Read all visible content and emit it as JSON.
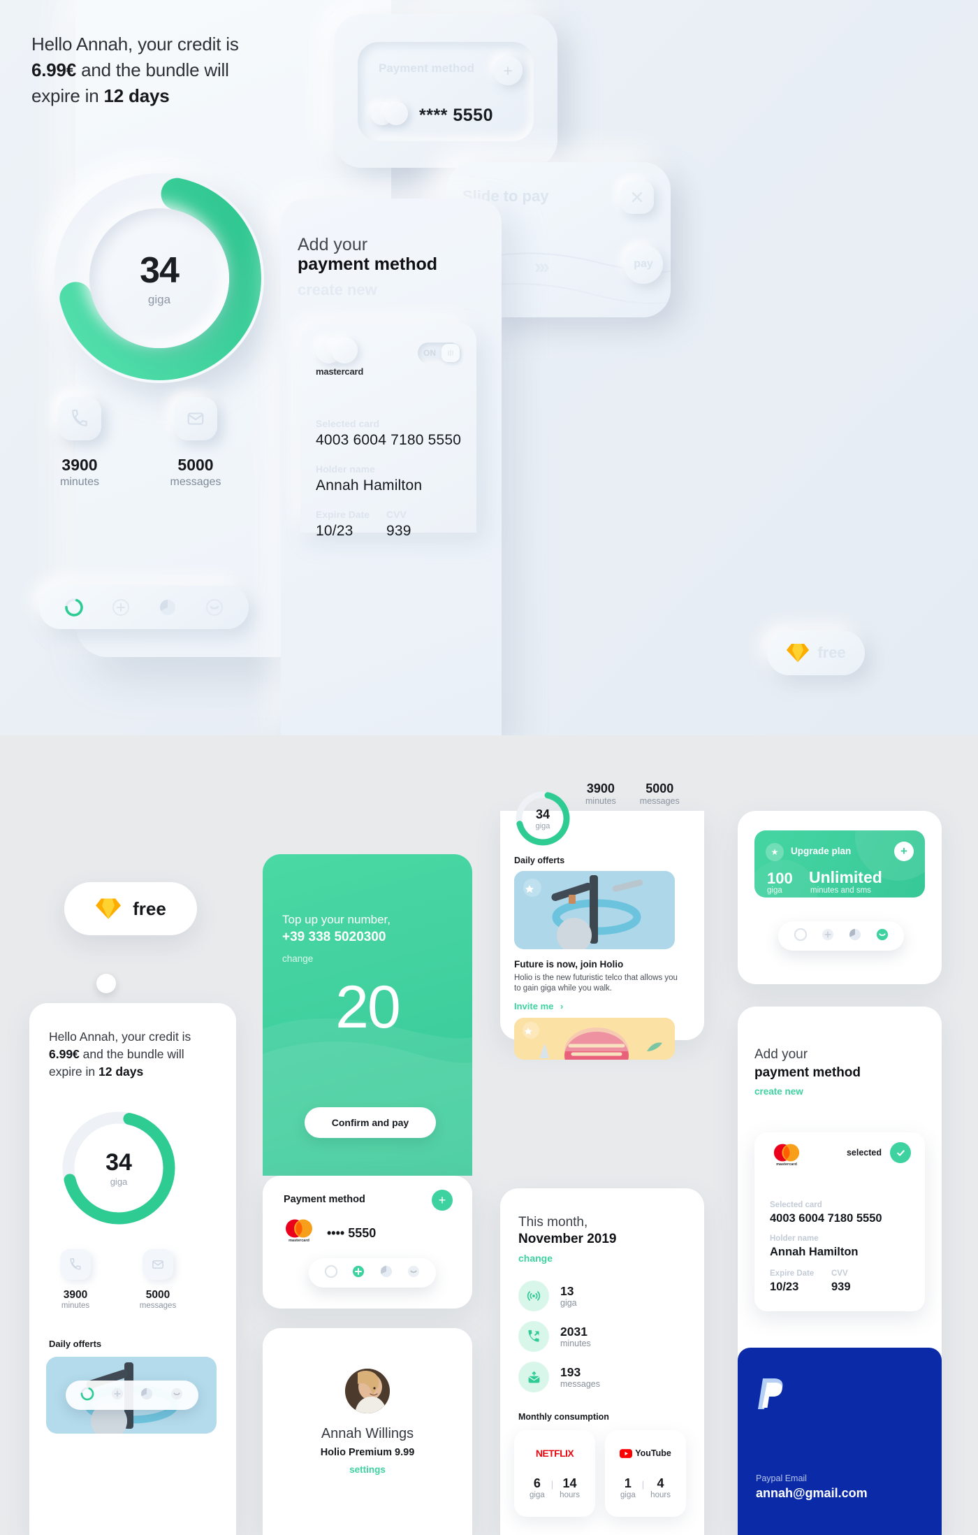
{
  "top": {
    "greeting": {
      "pre": "Hello Annah, your credit is ",
      "credit": "6.99€",
      "mid": " and the bundle will expire in ",
      "days": "12 days"
    },
    "donut": {
      "value": "34",
      "unit": "giga",
      "percent": 68
    },
    "stats": [
      {
        "icon": "phone-icon",
        "value": "3900",
        "label": "minutes"
      },
      {
        "icon": "envelope-icon",
        "value": "5000",
        "label": "messages"
      }
    ],
    "nav": [
      {
        "icon": "ring-icon",
        "active": true
      },
      {
        "icon": "plus-icon",
        "active": false
      },
      {
        "icon": "pie-icon",
        "active": false
      },
      {
        "icon": "smiley-icon",
        "active": false
      }
    ],
    "payment_method": {
      "title": "Payment method",
      "add_label": "+",
      "card_number": "**** 5550"
    },
    "slide_to_pay": {
      "title": "Slide to pay",
      "close_label": "×",
      "chevrons": "›››",
      "pay_label": "pay",
      "fingerprint": "fingerprint-icon"
    },
    "add_payment": {
      "line1": "Add your",
      "line2": "payment method",
      "link": "create new"
    },
    "card_detail": {
      "brand": "mastercard",
      "toggle_label": "ON",
      "selected_card_label": "Selected card",
      "selected_card_value": "4003 6004 7180 5550",
      "holder_label": "Holder name",
      "holder_value": "Annah Hamilton",
      "expire_label": "Expire Date",
      "expire_value": "10/23",
      "cvv_label": "CVV",
      "cvv_value": "939"
    },
    "free_badge": {
      "label": "free",
      "icon": "sketch-diamond-icon"
    }
  },
  "bottom": {
    "free_badge": {
      "label": "free",
      "icon": "sketch-diamond-icon"
    },
    "hello_card": {
      "greeting": {
        "pre": "Hello Annah, your credit is ",
        "credit": "6.99€",
        "mid": " and the bundle will expire in ",
        "days": "12 days"
      },
      "donut": {
        "value": "34",
        "unit": "giga",
        "percent": 68
      },
      "stats": [
        {
          "icon": "phone-icon",
          "value": "3900",
          "label": "minutes"
        },
        {
          "icon": "envelope-icon",
          "value": "5000",
          "label": "messages"
        }
      ],
      "daily_title": "Daily offerts"
    },
    "topup": {
      "title": "Top up your number,",
      "phone": "+39 338 5020300",
      "change": "change",
      "amount": "20",
      "button": "Confirm and pay"
    },
    "payment_method_card": {
      "title": "Payment method",
      "add_label": "+",
      "brand": "mastercard",
      "number": "•••• 5550",
      "nav": [
        {
          "icon": "ring-icon",
          "active": false
        },
        {
          "icon": "plus-icon",
          "active": true
        },
        {
          "icon": "pie-icon",
          "active": false
        },
        {
          "icon": "smiley-icon",
          "active": false
        }
      ]
    },
    "profile": {
      "name": "Annah Willings",
      "plan": "Holio Premium 9.99",
      "settings": "settings"
    },
    "dashboard": {
      "donut": {
        "value": "34",
        "unit": "giga",
        "percent": 68
      },
      "stats": [
        {
          "value": "3900",
          "label": "minutes"
        },
        {
          "value": "5000",
          "label": "messages"
        }
      ],
      "daily_title": "Daily offerts",
      "offer_title": "Future is now, join Holio",
      "offer_body": "Holio is the new futuristic telco that allows you to gain giga while you walk.",
      "offer_link": "Invite me",
      "offer_arrow": "›"
    },
    "month": {
      "title_line1": "This month,",
      "title_line2": "November 2019",
      "change": "change",
      "rows": [
        {
          "icon": "signal-icon",
          "value": "13",
          "label": "giga"
        },
        {
          "icon": "phone-icon",
          "value": "2031",
          "label": "minutes"
        },
        {
          "icon": "envelope-icon",
          "value": "193",
          "label": "messages"
        }
      ],
      "consumption_title": "Monthly consumption",
      "tiles": [
        {
          "brand": "NETFLIX",
          "giga": "6",
          "giga_label": "giga",
          "hours": "14",
          "hours_label": "hours"
        },
        {
          "brand": "YouTube",
          "giga": "1",
          "giga_label": "giga",
          "hours": "4",
          "hours_label": "hours"
        }
      ]
    },
    "upgrade": {
      "badge_icon": "star-icon",
      "title": "Upgrade plan",
      "add_label": "+",
      "giga_value": "100",
      "giga_label": "giga",
      "unlimited_value": "Unlimited",
      "unlimited_label": "minutes and sms",
      "nav": [
        {
          "icon": "ring-icon",
          "active": false
        },
        {
          "icon": "plus-icon",
          "active": false
        },
        {
          "icon": "pie-icon",
          "active": false
        },
        {
          "icon": "smiley-icon",
          "active": true
        }
      ]
    },
    "add_payment": {
      "line1": "Add your",
      "line2": "payment method",
      "link": "create new",
      "brand": "mastercard",
      "selected_label": "selected",
      "selected_card_label": "Selected card",
      "selected_card_value": "4003 6004 7180 5550",
      "holder_label": "Holder name",
      "holder_value": "Annah Hamilton",
      "expire_label": "Expire Date",
      "expire_value": "10/23",
      "cvv_label": "CVV",
      "cvv_value": "939",
      "paypal_label": "Paypal Email",
      "paypal_value": "annah@gmail.com"
    }
  },
  "colors": {
    "accent": "#3ed2a0",
    "accent_dark": "#35c896",
    "paypal_blue": "#0b2aa8",
    "netflix_red": "#e50914",
    "youtube_red": "#ff0000",
    "text": "#16181c",
    "muted": "#8b94a1"
  }
}
